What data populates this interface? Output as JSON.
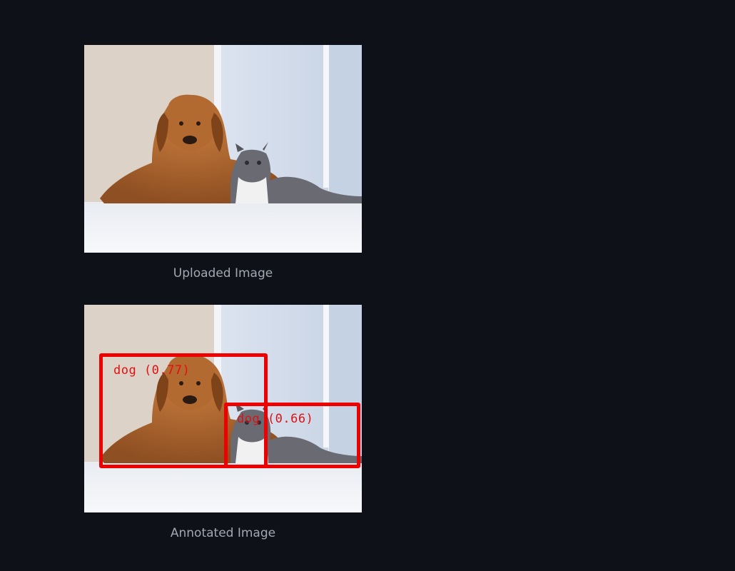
{
  "images": [
    {
      "caption": "Uploaded Image",
      "annotated": false
    },
    {
      "caption": "Annotated Image",
      "annotated": true,
      "detections": [
        {
          "label": "dog (0.77)",
          "class": "dog",
          "confidence": 0.77
        },
        {
          "label": "dog (0.66)",
          "class": "dog",
          "confidence": 0.66
        }
      ]
    }
  ],
  "colors": {
    "background": "#0e1117",
    "caption": "#a3a8b4",
    "box": "#ee0000"
  }
}
